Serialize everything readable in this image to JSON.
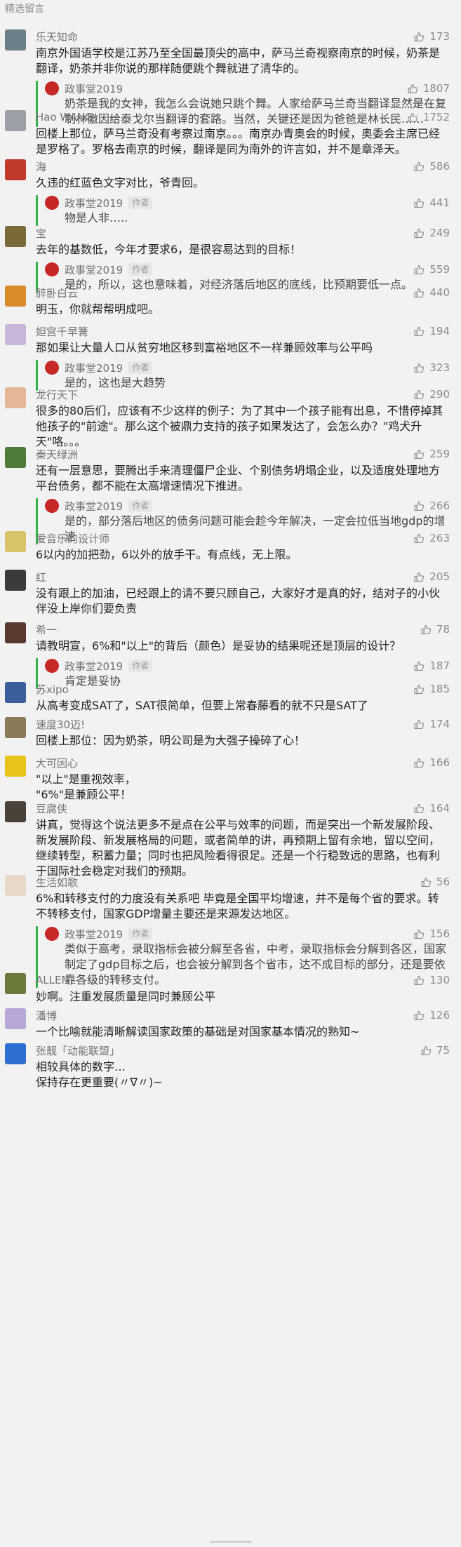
{
  "section_title": "精选留言",
  "comments": [
    {
      "nickname": "乐天知命",
      "likes": "173",
      "avatar_color": "#6b7f8a",
      "text": "南京外国语学校是江苏乃至全国最顶尖的高中，萨马兰奇视察南京的时候，奶茶是翻译，奶茶并非你说的那样随便跳个舞就进了清华的。",
      "reply": {
        "name": "政事堂2019",
        "tag": "",
        "likes": "1807",
        "text": "奶茶是我的女神，我怎么会说她只跳个舞。人家给萨马兰奇当翻译显然是在复制林徽因给泰戈尔当翻译的套路。当然，关键还是因为爸爸是林长民……"
      }
    },
    {
      "nickname": "Hao WANG",
      "likes": "1752",
      "avatar_color": "#9aa0a6",
      "text": "回楼上那位，萨马兰奇没有考察过南京。。。南京办青奥会的时候，奥委会主席已经是罗格了。罗格去南京的时候，翻译是同为南外的许言如，并不是章泽天。"
    },
    {
      "nickname": "海",
      "likes": "586",
      "avatar_color": "#c0392b",
      "text": "久违的红蓝色文字对比，爷青回。",
      "reply": {
        "name": "政事堂2019",
        "tag": "作者",
        "likes": "441",
        "text": "物是人非….."
      }
    },
    {
      "nickname": "宝",
      "likes": "249",
      "avatar_color": "#7a6a3a",
      "text": "去年的基数低，今年才要求6，是很容易达到的目标！",
      "reply": {
        "name": "政事堂2019",
        "tag": "作者",
        "likes": "559",
        "text": "是的，所以，这也意味着，对经济落后地区的底线，比预期要低一点。"
      }
    },
    {
      "nickname": "醉卧白云",
      "likes": "440",
      "avatar_color": "#d98c2b",
      "text": "明玉，你就帮帮明成吧。"
    },
    {
      "nickname": "妲宫千早篝",
      "likes": "194",
      "avatar_color": "#c9b6d8",
      "text": "那如果让大量人口从贫穷地区移到富裕地区不一样兼顾效率与公平吗",
      "reply": {
        "name": "政事堂2019",
        "tag": "作者",
        "likes": "323",
        "text": "是的，这也是大趋势"
      }
    },
    {
      "nickname": "龙行天下",
      "likes": "290",
      "avatar_color": "#e4b896",
      "text": "很多的80后们，应该有不少这样的例子：为了其中一个孩子能有出息，不惜停掉其他孩子的\"前途\"。那么这个被鼎力支持的孩子如果发达了，会怎么办？\"鸡犬升天\"咯。。。"
    },
    {
      "nickname": "秦天绿洲",
      "likes": "259",
      "avatar_color": "#4f7a3a",
      "text": "还有一层意思，要腾出手来清理僵尸企业、个别债务坍塌企业，以及适度处理地方平台债务，都不能在太高增速情况下推进。",
      "reply": {
        "name": "政事堂2019",
        "tag": "作者",
        "likes": "266",
        "text": "是的，部分落后地区的债务问题可能会趁今年解决，一定会拉低当地gdp的增速"
      }
    },
    {
      "nickname": "爱音乐的设计师",
      "likes": "263",
      "avatar_color": "#d8c36a",
      "text": "6以内的加把劲，6以外的放手干。有点线，无上限。"
    },
    {
      "nickname": "红",
      "likes": "205",
      "avatar_color": "#3a3a3a",
      "text": "没有跟上的加油，已经跟上的请不要只顾自己，大家好才是真的好，结对子的小伙伴没上岸你们要负责"
    },
    {
      "nickname": "希一",
      "likes": "78",
      "avatar_color": "#5a3a30",
      "text": "请教明宣，6%和\"以上\"的背后（颜色）是妥协的结果呢还是顶层的设计？",
      "reply": {
        "name": "政事堂2019",
        "tag": "作者",
        "likes": "187",
        "text": "肯定是妥协"
      }
    },
    {
      "nickname": "苏xipo",
      "likes": "185",
      "avatar_color": "#3a5f9a",
      "text": "从高考变成SAT了，SAT很简单，但要上常春藤看的就不只是SAT了"
    },
    {
      "nickname": "速度30迈!",
      "likes": "174",
      "avatar_color": "#8a7a5a",
      "text": "回楼上那位：因为奶茶，明公司是为大强子操碎了心！"
    },
    {
      "nickname": "大可因心",
      "likes": "166",
      "avatar_color": "#e8c31a",
      "text": "\"以上\"是重视效率，\n\"6%\"是兼顾公平！"
    },
    {
      "nickname": "豆腐侠",
      "likes": "164",
      "avatar_color": "#4a4238",
      "text": "讲真，觉得这个说法更多不是点在公平与效率的问题，而是突出一个新发展阶段、新发展阶段、新发展格局的问题，或者简单的讲，再预期上留有余地，留以空间，继续转型，积蓄力量；同时也把风险看得很足。还是一个行稳致远的思路，也有利于国际社会稳定对我们的预期。"
    },
    {
      "nickname": "生活如歌",
      "likes": "56",
      "avatar_color": "#e8d8c8",
      "text": "6%和转移支付的力度没有关系吧 毕竟是全国平均增速，并不是每个省的要求。转不转移支付，国家GDP增量主要还是来源发达地区。",
      "reply": {
        "name": "政事堂2019",
        "tag": "作者",
        "likes": "156",
        "text": "类似于高考，录取指标会被分解至各省，中考，录取指标会分解到各区，国家制定了gdp目标之后，也会被分解到各个省市，达不成目标的部分，还是要依靠各级的转移支付。"
      }
    },
    {
      "nickname": "ALLEN",
      "likes": "130",
      "avatar_color": "#6a7a3a",
      "text": "妙啊。注重发展质量是同时兼顾公平"
    },
    {
      "nickname": "潘博",
      "likes": "126",
      "avatar_color": "#b8a8d8",
      "text": "一个比喻就能清晰解读国家政策的基础是对国家基本情况的熟知~"
    },
    {
      "nickname": "张靓「动能联盟」",
      "likes": "75",
      "avatar_color": "#2f6fd1",
      "text": "相较具体的数字…\n保持存在更重要(〃∇〃)~"
    }
  ]
}
